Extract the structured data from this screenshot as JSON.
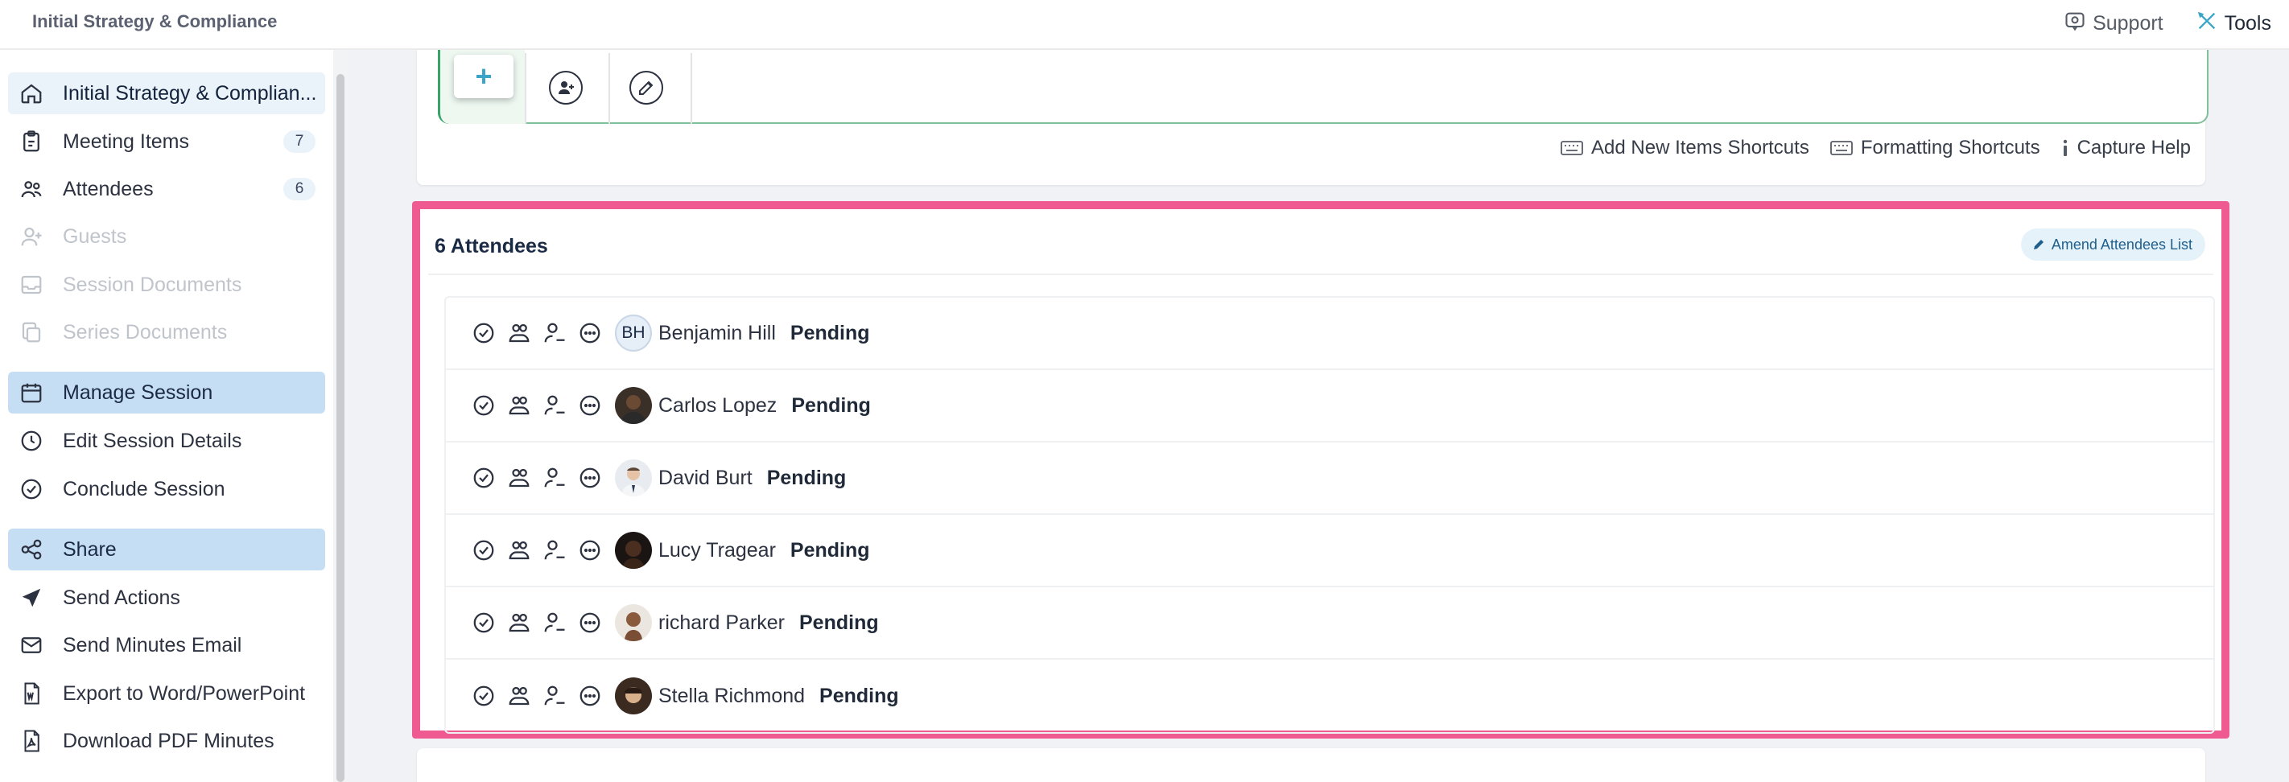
{
  "app": {
    "title": "Initial Strategy & Compliance"
  },
  "topbar": {
    "support_label": "Support",
    "tools_label": "Tools"
  },
  "sidebar": {
    "items": [
      {
        "label": "Initial Strategy & Complian...",
        "icon": "home-icon",
        "state": "active-soft"
      },
      {
        "label": "Meeting Items",
        "icon": "clipboard-icon",
        "count": "7"
      },
      {
        "label": "Attendees",
        "icon": "people-icon",
        "count": "6"
      },
      {
        "label": "Guests",
        "icon": "add-user-icon",
        "state": "disabled"
      },
      {
        "label": "Session Documents",
        "icon": "inbox-icon",
        "state": "disabled"
      },
      {
        "label": "Series Documents",
        "icon": "copy-icon",
        "state": "disabled"
      },
      {
        "label": "Manage Session",
        "icon": "calendar-icon",
        "state": "active"
      },
      {
        "label": "Edit Session Details",
        "icon": "clock-icon"
      },
      {
        "label": "Conclude Session",
        "icon": "check-circle-icon"
      },
      {
        "label": "Share",
        "icon": "share-icon",
        "state": "active"
      },
      {
        "label": "Send Actions",
        "icon": "paper-plane-icon"
      },
      {
        "label": "Send Minutes Email",
        "icon": "mail-icon"
      },
      {
        "label": "Export to Word/PowerPoint",
        "icon": "word-file-icon"
      },
      {
        "label": "Download PDF Minutes",
        "icon": "pdf-file-icon"
      }
    ]
  },
  "editor": {
    "plus_label": "+",
    "shortcuts": {
      "add_new": "Add New Items Shortcuts",
      "formatting": "Formatting Shortcuts",
      "capture_help": "Capture Help"
    }
  },
  "attendees": {
    "title": "6 Attendees",
    "amend_label": "Amend Attendees List",
    "rows": [
      {
        "name": "Benjamin Hill",
        "status": "Pending",
        "initials": "BH"
      },
      {
        "name": "Carlos Lopez",
        "status": "Pending"
      },
      {
        "name": "David Burt",
        "status": "Pending"
      },
      {
        "name": "Lucy Tragear",
        "status": "Pending"
      },
      {
        "name": "richard Parker",
        "status": "Pending"
      },
      {
        "name": "Stella Richmond",
        "status": "Pending"
      }
    ]
  },
  "colors": {
    "highlight_border": "#ef5b91",
    "sidebar_active": "#c6def4",
    "accent_green": "#3aa36a"
  }
}
